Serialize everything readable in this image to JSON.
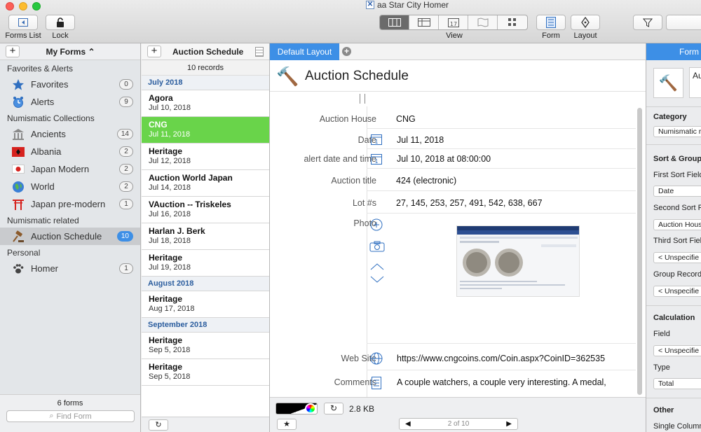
{
  "window": {
    "title": "aa Star City Homer"
  },
  "toolbar": {
    "forms_list": "Forms List",
    "lock": "Lock",
    "view": "View",
    "form": "Form",
    "layout": "Layout"
  },
  "sidebar": {
    "title": "My Forms",
    "groups": [
      {
        "label": "Favorites & Alerts",
        "items": [
          {
            "label": "Favorites",
            "count": "0",
            "icon": "star-icon"
          },
          {
            "label": "Alerts",
            "count": "9",
            "icon": "alarm-clock-icon"
          }
        ]
      },
      {
        "label": "Numismatic Collections",
        "items": [
          {
            "label": "Ancients",
            "count": "14",
            "icon": "temple-icon"
          },
          {
            "label": "Albania",
            "count": "2",
            "icon": "albania-flag-icon"
          },
          {
            "label": "Japan Modern",
            "count": "2",
            "icon": "japan-flag-icon"
          },
          {
            "label": "World",
            "count": "2",
            "icon": "globe-icon"
          },
          {
            "label": "Japan pre-modern",
            "count": "1",
            "icon": "torii-icon"
          }
        ]
      },
      {
        "label": "Numismatic related",
        "items": [
          {
            "label": "Auction Schedule",
            "count": "10",
            "icon": "gavel-icon",
            "selected": true
          }
        ]
      },
      {
        "label": "Personal",
        "items": [
          {
            "label": "Homer",
            "count": "1",
            "icon": "paw-icon"
          }
        ]
      }
    ],
    "footer": {
      "count": "6 forms",
      "search_placeholder": "Find Form"
    }
  },
  "records": {
    "title": "Auction Schedule",
    "count": "10 records",
    "sections": [
      {
        "label": "July 2018",
        "items": [
          {
            "title": "Agora",
            "date": "Jul 10, 2018"
          },
          {
            "title": "CNG",
            "date": "Jul 11, 2018",
            "selected": true
          },
          {
            "title": "Heritage",
            "date": "Jul 12, 2018"
          },
          {
            "title": "Auction World Japan",
            "date": "Jul 14, 2018"
          },
          {
            "title": "VAuction -- Triskeles",
            "date": "Jul 16, 2018"
          },
          {
            "title": "Harlan J. Berk",
            "date": "Jul 18, 2018"
          },
          {
            "title": "Heritage",
            "date": "Jul 19, 2018"
          }
        ]
      },
      {
        "label": "August 2018",
        "items": [
          {
            "title": "Heritage",
            "date": "Aug 17, 2018"
          }
        ]
      },
      {
        "label": "September 2018",
        "items": [
          {
            "title": "Heritage",
            "date": "Sep 5, 2018"
          },
          {
            "title": "Heritage",
            "date": "Sep 5, 2018"
          }
        ]
      }
    ]
  },
  "main": {
    "tab": "Default Layout",
    "form_title": "Auction Schedule",
    "fields": {
      "auction_house": {
        "label": "Auction House",
        "value": "CNG"
      },
      "date": {
        "label": "Date",
        "value": "Jul 11, 2018"
      },
      "alert": {
        "label": "alert date and time",
        "value": "Jul 10, 2018 at 08:00:00"
      },
      "auction_title": {
        "label": "Auction title",
        "value": "424 (electronic)"
      },
      "lots": {
        "label": "Lot #s",
        "value": "27, 145, 253, 257, 491, 542, 638, 667"
      },
      "photo": {
        "label": "Photo"
      },
      "website": {
        "label": "Web Site",
        "value": "https://www.cngcoins.com/Coin.aspx?CoinID=362535"
      },
      "comments": {
        "label": "Comments",
        "value": "A couple watchers, a couple very interesting.  A medal,"
      }
    },
    "footer": {
      "size": "2.8 KB",
      "pager": "2 of 10"
    }
  },
  "inspector": {
    "tab": "Form",
    "name_value": "Au",
    "category": {
      "heading": "Category",
      "value": "Numismatic r"
    },
    "sort": {
      "heading": "Sort & Group",
      "first_label": "First Sort Field",
      "first_value": "Date",
      "second_label": "Second Sort F",
      "second_value": "Auction Hous",
      "third_label": "Third Sort Fiel",
      "third_value": "< Unspecifie",
      "group_label": "Group Records",
      "group_value": "< Unspecifie"
    },
    "calculation": {
      "heading": "Calculation",
      "field_label": "Field",
      "field_value": "< Unspecifie",
      "type_label": "Type",
      "type_value": "Total"
    },
    "other": {
      "heading": "Other",
      "single_column": "Single Column"
    }
  },
  "colors": {
    "accent": "#3d8fe6",
    "selection_green": "#69d44a",
    "section_blue": "#2b5d9e"
  }
}
